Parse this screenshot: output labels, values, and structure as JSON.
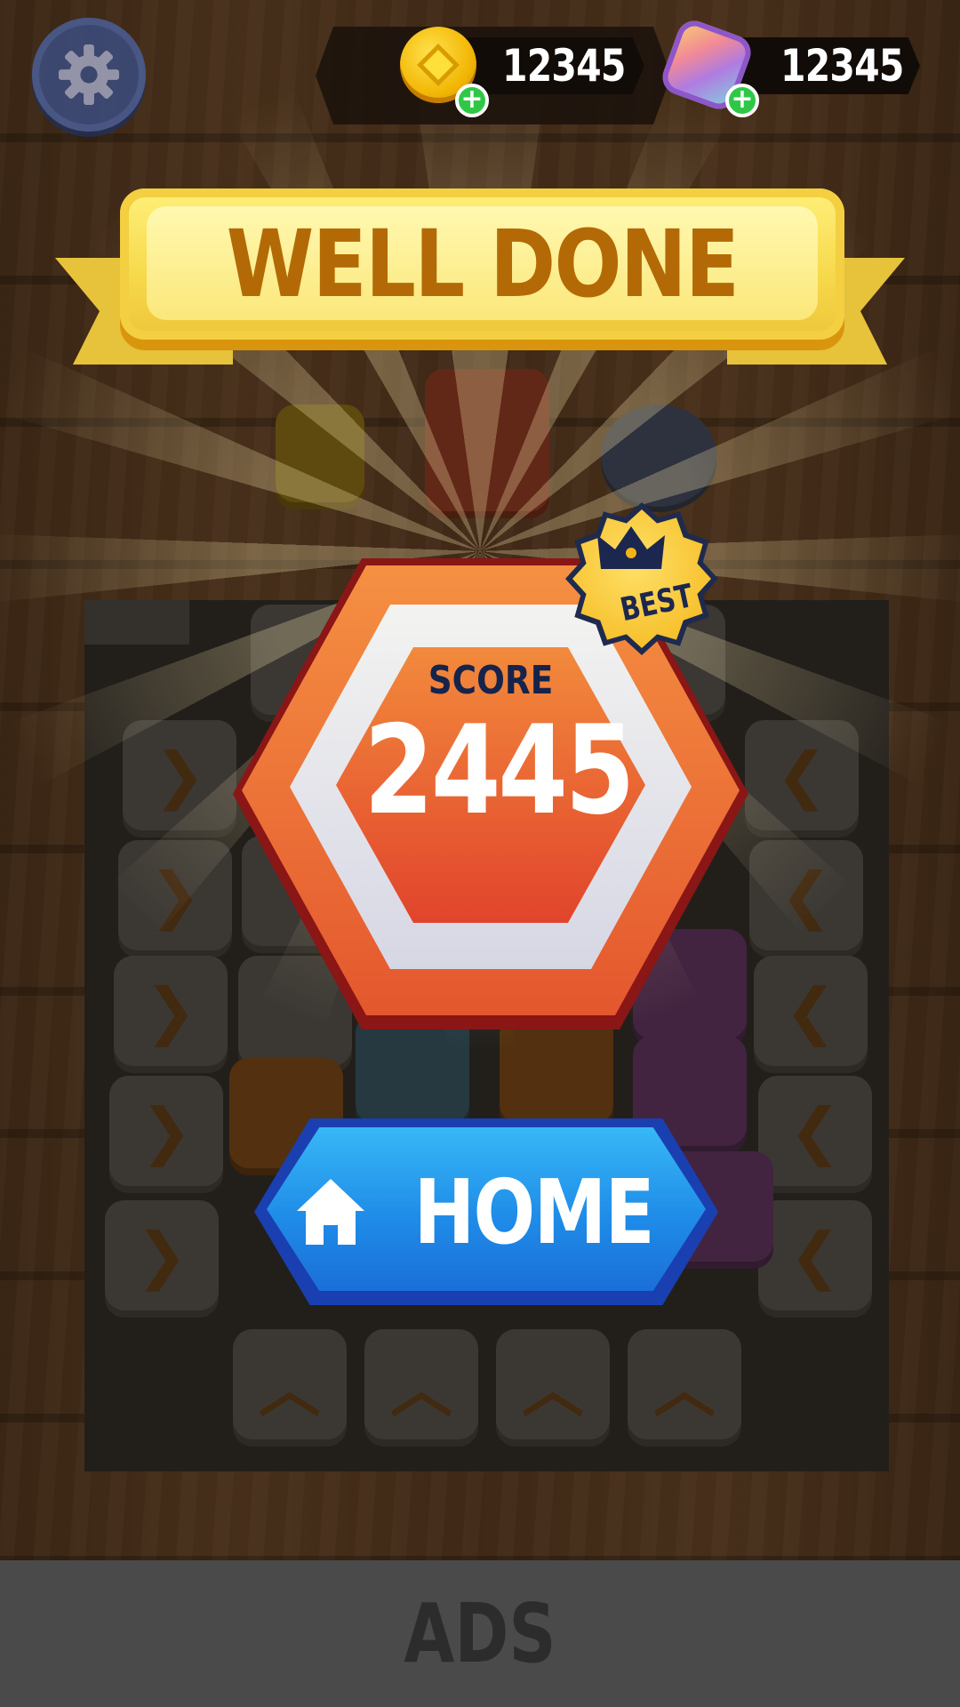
{
  "hud": {
    "settings_icon": "gear-icon",
    "coins": {
      "value": "12345",
      "icon": "coin-icon",
      "add_icon": "plus-icon"
    },
    "gems": {
      "value": "12345",
      "icon": "gem-icon",
      "add_icon": "plus-icon"
    },
    "plus_glyph": "+"
  },
  "banner": {
    "title": "WELL DONE"
  },
  "score": {
    "label": "SCORE",
    "value": "2445",
    "badge": "BEST",
    "badge_icon": "crown-icon"
  },
  "home_button": {
    "label": "HOME",
    "icon": "house-icon"
  },
  "ads": {
    "label": "ADS"
  },
  "board": {
    "arrow_right": "❯",
    "arrow_left": "❮",
    "arrow_up": "︿"
  },
  "colors": {
    "ribbon_text": "#b36a06",
    "score_hex": "#e4572e",
    "home_button": "#1f8ce8",
    "best_badge": "#f3b416"
  }
}
